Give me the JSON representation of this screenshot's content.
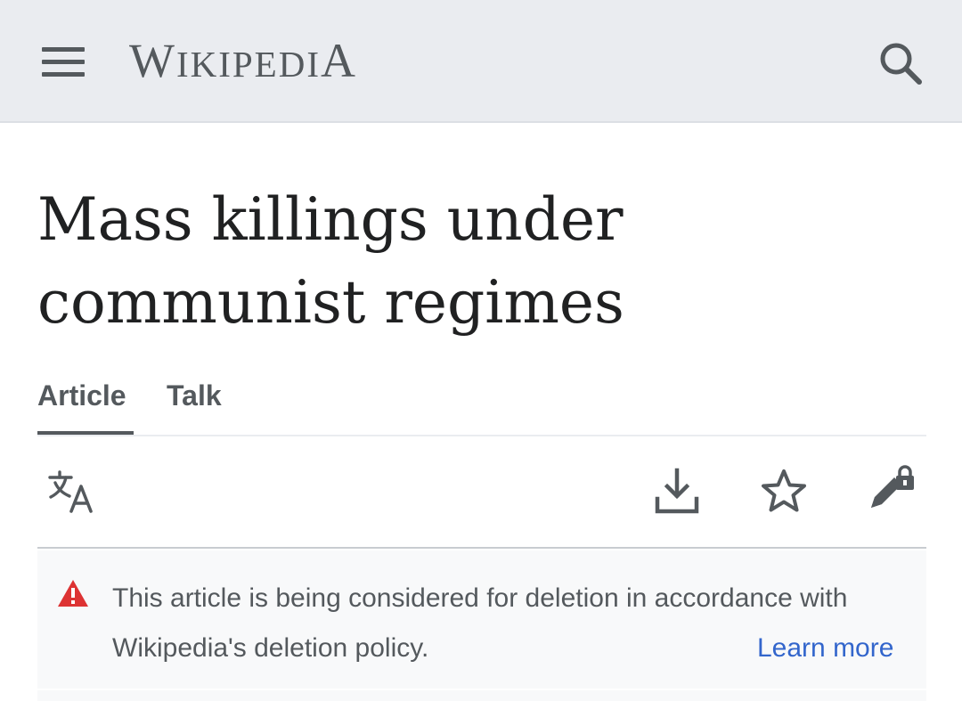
{
  "header": {
    "wordmark_first": "W",
    "wordmark_small": "IKIPEDI",
    "wordmark_last": "A",
    "menu_icon": "hamburger-menu-icon",
    "search_icon": "search-icon"
  },
  "article": {
    "title_line1": "Mass killings under",
    "title_line2": "communist regimes"
  },
  "tabs": [
    {
      "label": "Article",
      "active": true
    },
    {
      "label": "Talk",
      "active": false
    }
  ],
  "actions": {
    "language_icon": "language-icon",
    "download_icon": "download-icon",
    "watch_icon": "star-icon",
    "edit_icon": "edit-locked-icon"
  },
  "notice": {
    "icon": "warning-icon",
    "text": "This article is being considered for deletion in accordance with Wikipedia's deletion policy.",
    "link_label": "Learn more"
  },
  "colors": {
    "header_bg": "#eaecf0",
    "text": "#202122",
    "muted": "#54595d",
    "link": "#3366cc",
    "warning": "#d33"
  }
}
